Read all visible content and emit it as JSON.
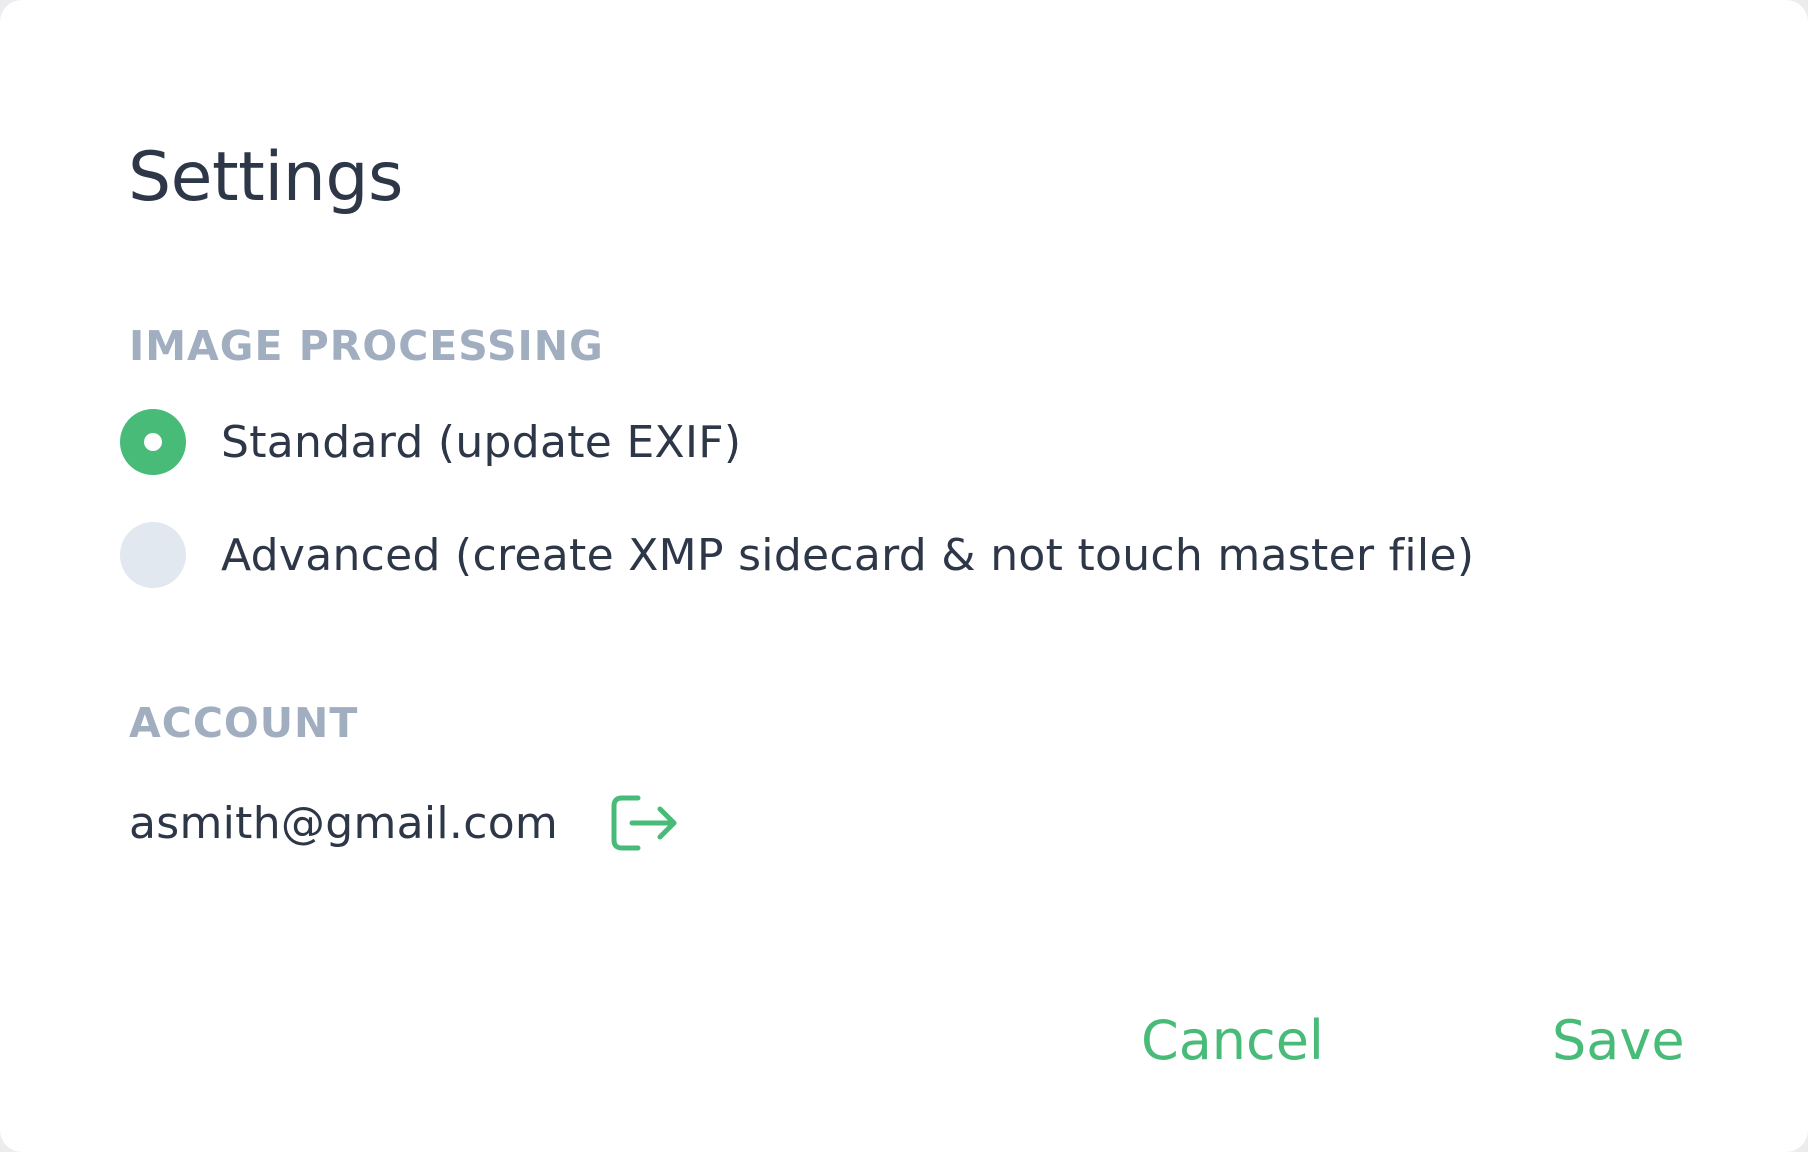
{
  "dialog": {
    "title": "Settings"
  },
  "image_processing": {
    "heading": "IMAGE PROCESSING",
    "options": [
      {
        "label": "Standard (update EXIF)",
        "selected": true
      },
      {
        "label": "Advanced (create XMP sidecard & not touch master file)",
        "selected": false
      }
    ]
  },
  "account": {
    "heading": "ACCOUNT",
    "email": "asmith@gmail.com",
    "logout_icon": "logout-icon"
  },
  "actions": {
    "cancel_label": "Cancel",
    "save_label": "Save"
  },
  "colors": {
    "accent": "#48bb78",
    "text": "#2d3748",
    "muted": "#a0aec0",
    "radio_off": "#e2e8f0"
  }
}
